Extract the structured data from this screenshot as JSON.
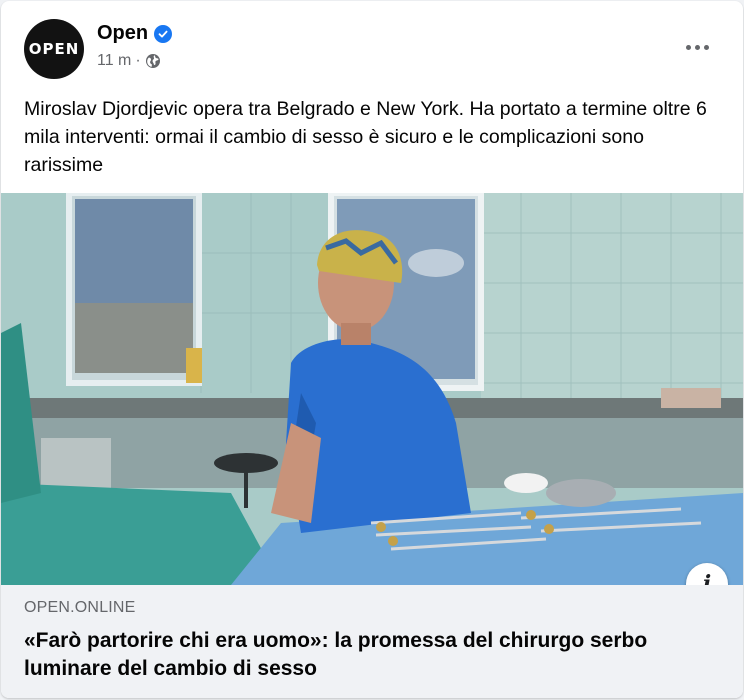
{
  "post": {
    "page_name": "Open",
    "avatar_text": "OPEN",
    "time": "11 m",
    "separator": "·",
    "privacy_icon": "globe-icon",
    "more_icon": "more-horizontal-icon",
    "verified_icon": "verified-badge-icon",
    "text": "Miroslav Djordjevic opera tra Belgrado e New York. Ha portato a termine oltre 6 mila interventi: ormai il cambio di sesso è sicuro e le complicazioni sono rarissime"
  },
  "link": {
    "domain": "OPEN.ONLINE",
    "title": "«Farò partorire chi era uomo»: la promessa del chirurgo serbo luminare del cambio di sesso",
    "info_label": "i"
  },
  "colors": {
    "brand_blue": "#1877f2",
    "text_primary": "#050505",
    "text_secondary": "#65676b",
    "preview_bg": "#f0f2f5"
  }
}
